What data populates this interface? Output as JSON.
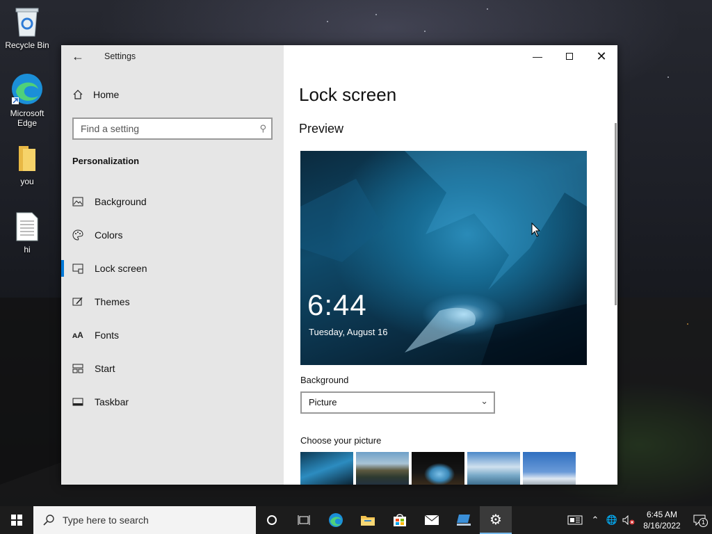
{
  "desktop": {
    "icons": [
      {
        "label": "Recycle Bin",
        "icon": "recycle-bin-icon"
      },
      {
        "label": "Microsoft Edge",
        "icon": "edge-icon"
      },
      {
        "label": "you",
        "icon": "folder-icon"
      },
      {
        "label": "hi",
        "icon": "text-document-icon"
      }
    ]
  },
  "window": {
    "title": "Settings",
    "back_icon": "back-arrow-icon",
    "controls": {
      "minimize": "minimize-icon",
      "maximize": "maximize-icon",
      "close": "close-icon"
    }
  },
  "sidebar": {
    "home_label": "Home",
    "search_placeholder": "Find a setting",
    "section_title": "Personalization",
    "items": [
      {
        "label": "Background",
        "icon": "background-image-icon",
        "active": false
      },
      {
        "label": "Colors",
        "icon": "palette-icon",
        "active": false
      },
      {
        "label": "Lock screen",
        "icon": "lock-screen-icon",
        "active": true
      },
      {
        "label": "Themes",
        "icon": "themes-brush-icon",
        "active": false
      },
      {
        "label": "Fonts",
        "icon": "fonts-icon",
        "active": false
      },
      {
        "label": "Start",
        "icon": "start-grid-icon",
        "active": false
      },
      {
        "label": "Taskbar",
        "icon": "taskbar-icon",
        "active": false
      }
    ]
  },
  "main": {
    "page_title": "Lock screen",
    "preview_label": "Preview",
    "preview_time": "6:44",
    "preview_date": "Tuesday, August 16",
    "background_label": "Background",
    "background_value": "Picture",
    "choose_picture_label": "Choose your picture",
    "thumbnails": [
      "ice-cave",
      "mountain-lake",
      "cave-opening",
      "beach-hammock",
      "blue-sky"
    ]
  },
  "taskbar": {
    "search_placeholder": "Type here to search",
    "apps": [
      "cortana-icon",
      "task-view-icon",
      "edge-icon",
      "file-explorer-icon",
      "store-icon",
      "mail-icon",
      "ie-app-icon",
      "settings-gear-icon"
    ],
    "active_app": "settings-gear-icon",
    "clock_time": "6:45 AM",
    "clock_date": "8/16/2022",
    "notification_count": "1"
  },
  "colors": {
    "accent": "#0078d7",
    "sidebar_bg": "#e6e6e6",
    "taskbar_bg": "#1c1c1c"
  }
}
